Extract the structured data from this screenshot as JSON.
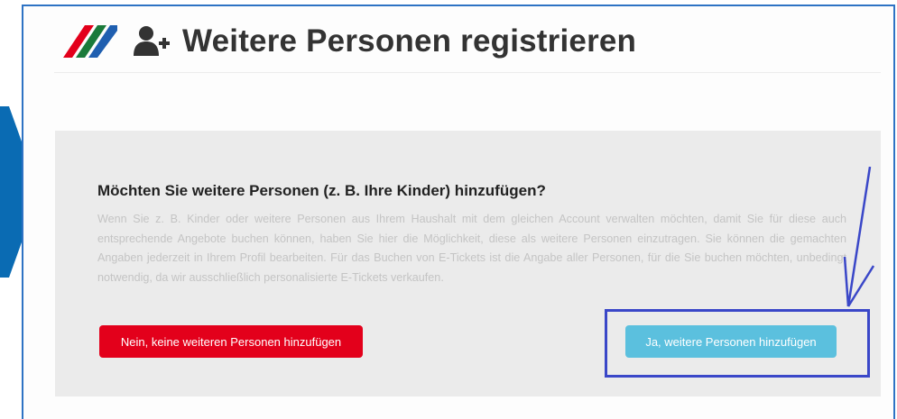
{
  "header": {
    "title": "Weitere Personen registrieren",
    "logo_icon": "brand-logo-stripes-icon",
    "title_icon": "user-plus-icon"
  },
  "panel": {
    "question": "Möchten Sie weitere Personen (z. B. Ihre Kinder) hinzufügen?",
    "description": "Wenn Sie z. B. Kinder oder weitere Personen aus Ihrem Haushalt mit dem gleichen Account verwalten möchten, damit Sie für diese auch entsprechende Angebote buchen können, haben Sie hier die Möglichkeit, diese als weitere Personen einzutragen. Sie können die gemachten Angaben jederzeit in Ihrem Profil bearbeiten. Für das Buchen von E-Tickets ist die Angabe aller Personen, für die Sie buchen möchten, unbedingt notwendig, da wir ausschließlich personalisierte E-Tickets verkaufen.",
    "no_button": "Nein, keine weiteren Personen hinzufügen",
    "yes_button": "Ja, weitere Personen hinzufügen"
  },
  "colors": {
    "frame_border": "#2e73c4",
    "no_button": "#e3001b",
    "yes_button": "#5bc0de",
    "annotation": "#3a47c8",
    "arrow_marker": "#0a6bb3"
  }
}
